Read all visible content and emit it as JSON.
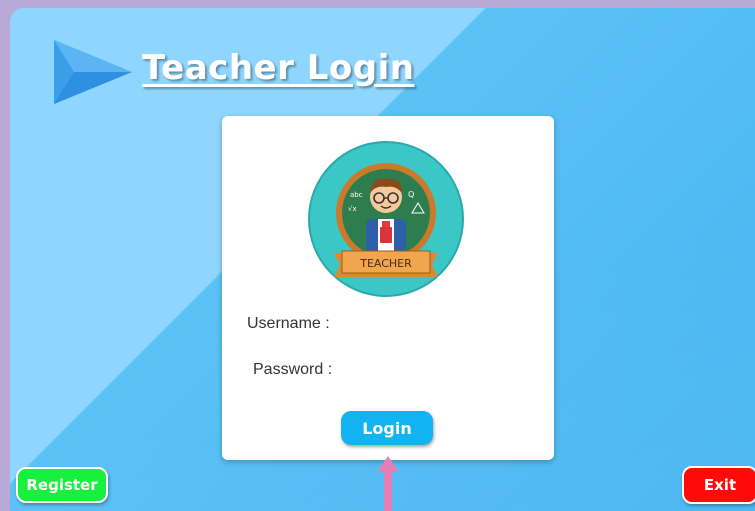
{
  "header": {
    "title": "Teacher Login"
  },
  "login_card": {
    "avatar_badge_text": "TEACHER",
    "username_label": "Username :",
    "username_value": "",
    "password_label": "Password :",
    "password_value": "",
    "login_label": "Login"
  },
  "footer": {
    "register_label": "Register",
    "exit_label": "Exit"
  },
  "icons": {
    "title_arrow": "play-arrow-icon",
    "avatar": "teacher-avatar-icon",
    "pointer": "up-arrow-icon"
  },
  "colors": {
    "background_light": "#8fd6ff",
    "background_dark": "#45b4f0",
    "login_button": "#11b4f0",
    "register_button": "#17f03c",
    "exit_button": "#ff0a0a",
    "pointer_arrow": "#e57fb3"
  }
}
